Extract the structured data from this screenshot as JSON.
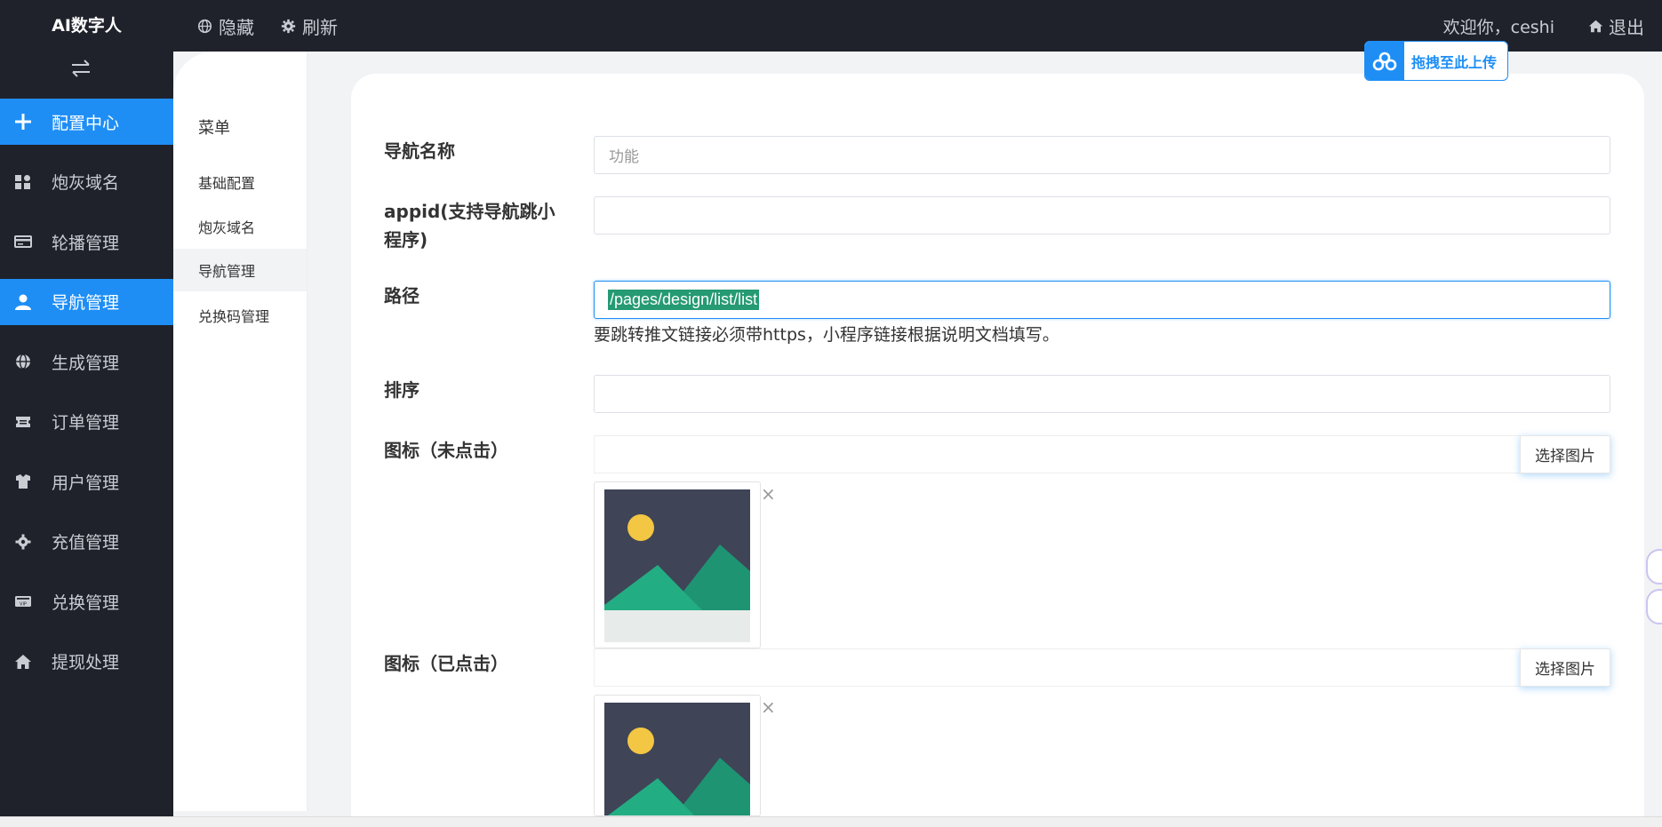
{
  "app": {
    "brand": "AI数字人",
    "hide_label": "隐藏",
    "refresh_label": "刷新",
    "welcome": "欢迎你，ceshi",
    "logout_label": "退出"
  },
  "sidebar": {
    "items": [
      {
        "label": "配置中心",
        "icon": "plus-icon",
        "active": true
      },
      {
        "label": "炮灰域名",
        "icon": "apps-icon",
        "active": false
      },
      {
        "label": "轮播管理",
        "icon": "card-icon",
        "active": false
      },
      {
        "label": "导航管理",
        "icon": "user-icon",
        "active": true
      },
      {
        "label": "生成管理",
        "icon": "globe-icon",
        "active": false
      },
      {
        "label": "订单管理",
        "icon": "ticket-icon",
        "active": false
      },
      {
        "label": "用户管理",
        "icon": "shirt-icon",
        "active": false
      },
      {
        "label": "充值管理",
        "icon": "gear-icon",
        "active": false
      },
      {
        "label": "兑换管理",
        "icon": "vip-card-icon",
        "active": false
      },
      {
        "label": "提现处理",
        "icon": "home-icon",
        "active": false
      }
    ]
  },
  "submenu": {
    "title": "菜单",
    "items": [
      {
        "label": "基础配置",
        "active": false
      },
      {
        "label": "炮灰域名",
        "active": false
      },
      {
        "label": "导航管理",
        "active": true
      },
      {
        "label": "兑换码管理",
        "active": false
      }
    ]
  },
  "form": {
    "nav_name_label": "导航名称",
    "nav_name_placeholder": "功能",
    "appid_label_line1": "appid(支持导航跳小",
    "appid_label_line2": "程序)",
    "appid_value": "",
    "path_label": "路径",
    "path_value": "/pages/design/list/list",
    "path_hint": "要跳转推文链接必须带https，小程序链接根据说明文档填写。",
    "sort_label": "排序",
    "sort_value": "",
    "icon_unclicked_label": "图标（未点击）",
    "icon_clicked_label": "图标（已点击）",
    "choose_image_label": "选择图片",
    "close_glyph": "×"
  },
  "upload_badge": {
    "label": "拖拽至此上传"
  },
  "colors": {
    "accent": "#1e8ef5",
    "sidebar_bg": "#1f222b",
    "selection": "#259a73"
  }
}
